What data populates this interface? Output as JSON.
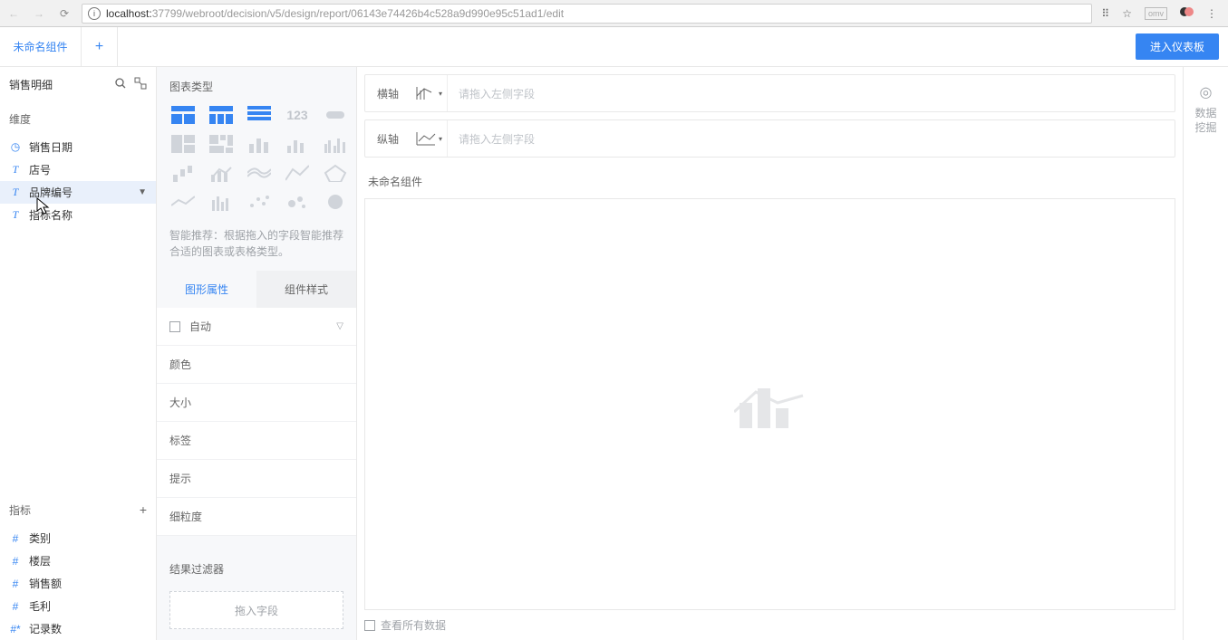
{
  "browser": {
    "url_host": "localhost:",
    "url_rest": "37799/webroot/decision/v5/design/report/06143e74426b4c528a9d990e95c51ad1/edit"
  },
  "tabs": {
    "first": "未命名组件"
  },
  "header": {
    "dashboard_btn": "进入仪表板"
  },
  "left": {
    "data_source": "销售明细",
    "dims_label": "维度",
    "dims": [
      "销售日期",
      "店号",
      "品牌编号",
      "指标名称"
    ],
    "metrics_label": "指标",
    "metrics": [
      "类别",
      "楼层",
      "销售额",
      "毛利",
      "记录数"
    ]
  },
  "middle": {
    "chart_type_title": "图表类型",
    "num_icon": "123",
    "recommend": "智能推荐：根据拖入的字段智能推荐合适的图表或表格类型。",
    "tab1": "图形属性",
    "tab2": "组件样式",
    "auto": "自动",
    "color": "颜色",
    "size": "大小",
    "label": "标签",
    "tooltip": "提示",
    "granularity": "细粒度",
    "filter_title": "结果过滤器",
    "filter_drop": "拖入字段"
  },
  "right": {
    "h_axis": "横轴",
    "v_axis": "纵轴",
    "drop_hint": "请拖入左侧字段",
    "canvas_title": "未命名组件",
    "show_all_data": "查看所有数据",
    "mining_label": "数据\n挖掘"
  }
}
